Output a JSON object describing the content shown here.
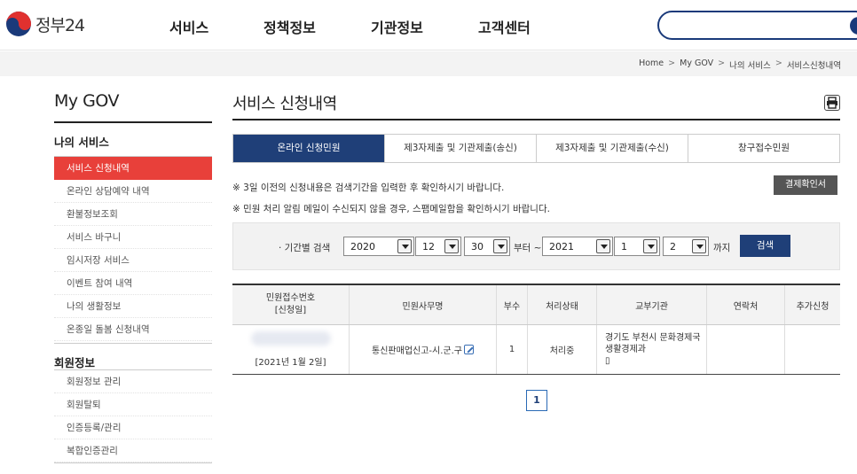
{
  "header": {
    "logo_text": "정부24",
    "nav": [
      "서비스",
      "정책정보",
      "기관정보",
      "고객센터"
    ],
    "brand_color": "#1a3a7a"
  },
  "breadcrumb": [
    "Home",
    "My GOV",
    "나의 서비스",
    "서비스신청내역"
  ],
  "sidebar": {
    "title": "My GOV",
    "section1": "나의 서비스",
    "items1": [
      "서비스 신청내역",
      "온라인 상담예약 내역",
      "환불정보조회",
      "서비스 바구니",
      "임시저장 서비스",
      "이벤트 참여 내역",
      "나의 생활정보",
      "온종일 돌봄 신청내역"
    ],
    "section2": "회원정보",
    "items2": [
      "회원정보 관리",
      "회원탈퇴",
      "인증등록/관리",
      "복합인증관리"
    ],
    "active_color": "#e8403a"
  },
  "main": {
    "title": "서비스 신청내역",
    "tabs": [
      "온라인 신청민원",
      "제3자제출 및 기관제출(송신)",
      "제3자제출 및 기관제출(수신)",
      "창구접수민원"
    ],
    "notice1": "※ 3일 이전의 신청내용은 검색기간을 입력한 후 확인하시기 바랍니다.",
    "notice2": "※ 민원 처리 알림 메일이 수신되지 않을 경우, 스팸메일함을 확인하시기 바랍니다.",
    "receipt_button": "결제확인서",
    "filter": {
      "label": "· 기간별 검색",
      "from_year": "2020",
      "from_month": "12",
      "from_day": "30",
      "from_text": "부터 ~",
      "to_year": "2021",
      "to_month": "1",
      "to_day": "2",
      "to_text": "까지",
      "search_button": "검색"
    },
    "table": {
      "headers": [
        "민원접수번호\n[신청일]",
        "민원사무명",
        "부수",
        "처리상태",
        "교부기관",
        "연락처",
        "추가신청"
      ],
      "header_line1": "민원접수번호",
      "header_line2": "[신청일]",
      "rows": [
        {
          "date": "[2021년 1월 2일]",
          "name": "통신판매업신고-시.군.구",
          "copies": "1",
          "status": "처리중",
          "agency": "경기도 부천시 문화경제국 생활경제과",
          "agency_extra": "▯",
          "contact": "",
          "extra": ""
        }
      ]
    },
    "pager": "1"
  }
}
